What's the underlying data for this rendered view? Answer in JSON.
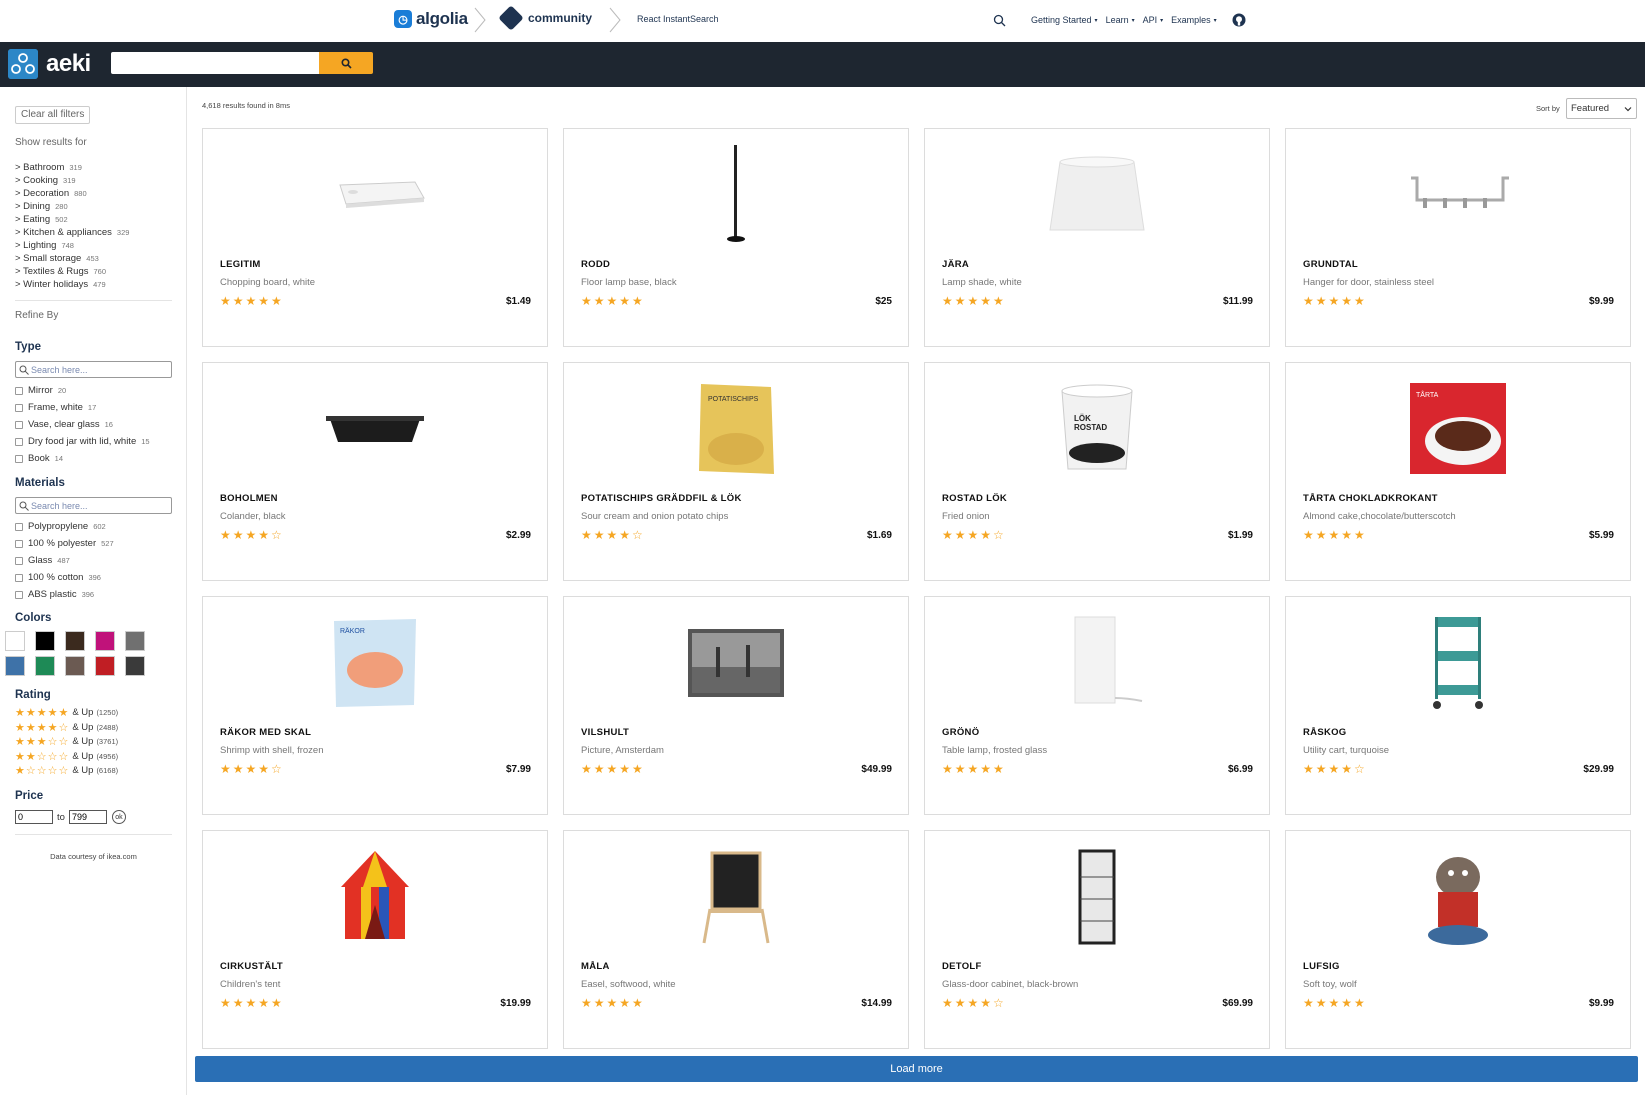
{
  "topnav": {
    "brand": "algolia",
    "community": "community",
    "product": "React InstantSearch",
    "links": [
      "Getting Started",
      "Learn",
      "API",
      "Examples"
    ]
  },
  "header": {
    "app_name": "aeki",
    "search_value": ""
  },
  "sidebar": {
    "clear_label": "Clear all filters",
    "show_results_for": "Show results for",
    "categories": [
      {
        "label": "> Bathroom",
        "count": "319"
      },
      {
        "label": "> Cooking",
        "count": "319"
      },
      {
        "label": "> Decoration",
        "count": "880"
      },
      {
        "label": "> Dining",
        "count": "280"
      },
      {
        "label": "> Eating",
        "count": "502"
      },
      {
        "label": "> Kitchen & appliances",
        "count": "329"
      },
      {
        "label": "> Lighting",
        "count": "748"
      },
      {
        "label": "> Small storage",
        "count": "453"
      },
      {
        "label": "> Textiles & Rugs",
        "count": "760"
      },
      {
        "label": "> Winter holidays",
        "count": "479"
      }
    ],
    "refine_by": "Refine By",
    "type": {
      "title": "Type",
      "placeholder": "Search here...",
      "items": [
        {
          "label": "Mirror",
          "count": "20"
        },
        {
          "label": "Frame, white",
          "count": "17"
        },
        {
          "label": "Vase, clear glass",
          "count": "16"
        },
        {
          "label": "Dry food jar with lid, white",
          "count": "15"
        },
        {
          "label": "Book",
          "count": "14"
        }
      ]
    },
    "materials": {
      "title": "Materials",
      "placeholder": "Search here...",
      "items": [
        {
          "label": "Polypropylene",
          "count": "602"
        },
        {
          "label": "100 % polyester",
          "count": "527"
        },
        {
          "label": "Glass",
          "count": "487"
        },
        {
          "label": "100 % cotton",
          "count": "396"
        },
        {
          "label": "ABS plastic",
          "count": "396"
        }
      ]
    },
    "colors": {
      "title": "Colors",
      "swatches": [
        "#ffffff",
        "#000000",
        "#3b2a1e",
        "#c0127a",
        "#707070",
        "#3e72a8",
        "#1e8a56",
        "#6b5a52",
        "#c01e24",
        "#3a3a3a"
      ]
    },
    "rating": {
      "title": "Rating",
      "rows": [
        {
          "stars": 5,
          "label": "& Up",
          "count": "(1250)"
        },
        {
          "stars": 4,
          "label": "& Up",
          "count": "(2488)"
        },
        {
          "stars": 3,
          "label": "& Up",
          "count": "(3761)"
        },
        {
          "stars": 2,
          "label": "& Up",
          "count": "(4956)"
        },
        {
          "stars": 1,
          "label": "& Up",
          "count": "(6168)"
        }
      ]
    },
    "price": {
      "title": "Price",
      "min": "0",
      "max": "799",
      "to": "to",
      "ok": "ok"
    },
    "courtesy": "Data courtesy of ikea.com"
  },
  "results": {
    "stats": "4,618 results found in 8ms",
    "sort_label": "Sort by",
    "sort_value": "Featured",
    "load_more": "Load more",
    "products": [
      {
        "name": "LEGITIM",
        "desc": "Chopping board, white",
        "price": "$1.49",
        "rating": 5,
        "icon": "chopping-board-image"
      },
      {
        "name": "RODD",
        "desc": "Floor lamp base, black",
        "price": "$25",
        "rating": 5,
        "icon": "floor-lamp-image"
      },
      {
        "name": "JÄRA",
        "desc": "Lamp shade, white",
        "price": "$11.99",
        "rating": 5,
        "icon": "lamp-shade-image"
      },
      {
        "name": "GRUNDTAL",
        "desc": "Hanger for door, stainless steel",
        "price": "$9.99",
        "rating": 5,
        "icon": "door-hanger-image"
      },
      {
        "name": "BOHOLMEN",
        "desc": "Colander, black",
        "price": "$2.99",
        "rating": 4,
        "icon": "colander-image"
      },
      {
        "name": "POTATISCHIPS GRÄDDFIL & LÖK",
        "desc": "Sour cream and onion potato chips",
        "price": "$1.69",
        "rating": 4,
        "icon": "chips-bag-image"
      },
      {
        "name": "ROSTAD LÖK",
        "desc": "Fried onion",
        "price": "$1.99",
        "rating": 4,
        "icon": "fried-onion-tub-image"
      },
      {
        "name": "TÅRTA CHOKLADKROKANT",
        "desc": "Almond cake,chocolate/butterscotch",
        "price": "$5.99",
        "rating": 5,
        "icon": "cake-box-image"
      },
      {
        "name": "RÄKOR MED SKAL",
        "desc": "Shrimp with shell, frozen",
        "price": "$7.99",
        "rating": 4,
        "icon": "shrimp-bag-image"
      },
      {
        "name": "VILSHULT",
        "desc": "Picture, Amsterdam",
        "price": "$49.99",
        "rating": 5,
        "icon": "picture-frame-image"
      },
      {
        "name": "GRÖNÖ",
        "desc": "Table lamp, frosted glass",
        "price": "$6.99",
        "rating": 5,
        "icon": "table-lamp-image"
      },
      {
        "name": "RÅSKOG",
        "desc": "Utility cart, turquoise",
        "price": "$29.99",
        "rating": 4,
        "icon": "utility-cart-image"
      },
      {
        "name": "CIRKUSTÄLT",
        "desc": "Children's tent",
        "price": "$19.99",
        "rating": 5,
        "icon": "circus-tent-image"
      },
      {
        "name": "MÅLA",
        "desc": "Easel, softwood, white",
        "price": "$14.99",
        "rating": 5,
        "icon": "easel-image"
      },
      {
        "name": "DETOLF",
        "desc": "Glass-door cabinet, black-brown",
        "price": "$69.99",
        "rating": 4,
        "icon": "glass-cabinet-image"
      },
      {
        "name": "LUFSIG",
        "desc": "Soft toy, wolf",
        "price": "$9.99",
        "rating": 5,
        "icon": "wolf-toy-image"
      }
    ]
  }
}
